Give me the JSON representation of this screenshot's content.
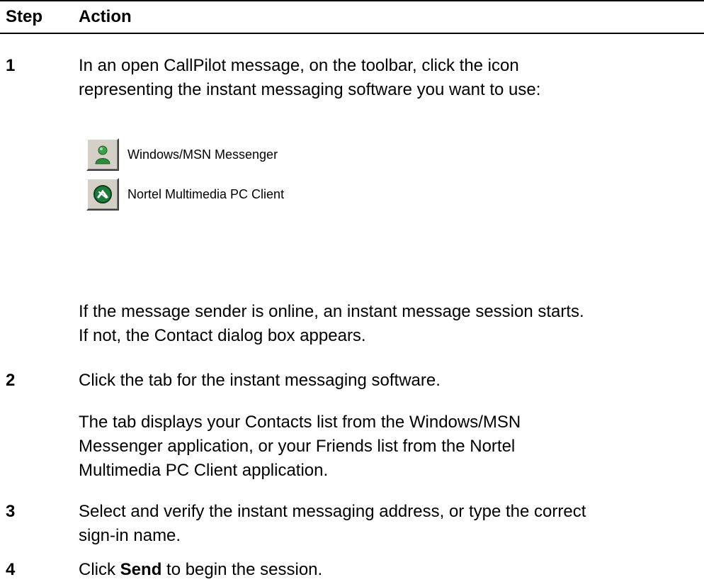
{
  "table": {
    "header": {
      "step": "Step",
      "action": "Action"
    }
  },
  "steps": {
    "s1": {
      "number": "1",
      "line1": "In an open CallPilot message, on the toolbar, click the icon",
      "line2": "representing the instant messaging software you want to use:",
      "toolbar": [
        {
          "label": "Windows/MSN Messenger",
          "icon": "msn-messenger-icon"
        },
        {
          "label": "Nortel Multimedia PC Client",
          "icon": "nortel-multimedia-icon"
        }
      ],
      "after1": "If the message sender is online, an instant message session starts.",
      "after2": "If not, the Contact dialog box appears."
    },
    "s2": {
      "number": "2",
      "line1": "Click the tab for the instant messaging software.",
      "desc1": "The tab displays your Contacts list from the Windows/MSN",
      "desc2": "Messenger application, or your Friends list from the Nortel",
      "desc3": "Multimedia PC Client application."
    },
    "s3": {
      "number": "3",
      "line1": "Select and verify the instant messaging address, or type the correct",
      "line2": "sign-in name."
    },
    "s4": {
      "number": "4",
      "pre": "Click ",
      "bold": "Send",
      "post": " to begin the session."
    }
  },
  "colors": {
    "button_face": "#d4d0c8",
    "msn_icon_green": "#2e8b3a",
    "nortel_icon_green": "#1f7a3c"
  }
}
